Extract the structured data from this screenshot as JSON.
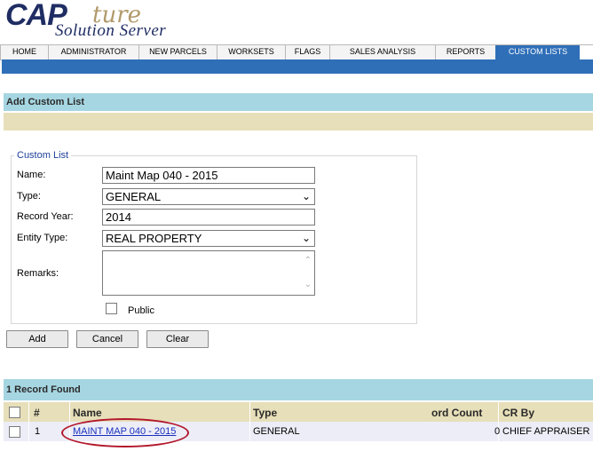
{
  "logo": {
    "cap": "CAP",
    "ture": "ture",
    "subtitle": "Solution Server"
  },
  "nav": {
    "tabs": [
      {
        "label": "HOME",
        "active": false
      },
      {
        "label": "ADMINISTRATOR",
        "active": false
      },
      {
        "label": "NEW PARCELS",
        "active": false
      },
      {
        "label": "WORKSETS",
        "active": false
      },
      {
        "label": "FLAGS",
        "active": false
      },
      {
        "label": "SALES ANALYSIS",
        "active": false
      },
      {
        "label": "REPORTS",
        "active": false
      },
      {
        "label": "CUSTOM LISTS",
        "active": true
      }
    ]
  },
  "form": {
    "section_title": "Add Custom List",
    "legend": "Custom List",
    "name_label": "Name:",
    "name_value": "Maint Map 040 - 2015",
    "type_label": "Type:",
    "type_value": "GENERAL",
    "record_year_label": "Record Year:",
    "record_year_value": "2014",
    "entity_type_label": "Entity Type:",
    "entity_type_value": "REAL PROPERTY",
    "remarks_label": "Remarks:",
    "remarks_value": "",
    "public_label": "Public",
    "public_checked": false,
    "add_label": "Add",
    "cancel_label": "Cancel",
    "clear_label": "Clear"
  },
  "results": {
    "title": "1 Record Found",
    "columns": {
      "num": "#",
      "name": "Name",
      "type": "Type",
      "record_count": "ord Count",
      "cr_by": "CR By"
    },
    "rows": [
      {
        "num": "1",
        "name": "MAINT MAP 040 - 2015",
        "type": "GENERAL",
        "record_count": "0",
        "cr_by": "CHIEF APPRAISER"
      }
    ]
  },
  "colors": {
    "nav_active": "#2f6fb8",
    "section_bar": "#a6d6e2",
    "tan_bar": "#e7dfb9",
    "annotation_oval": "#b3172b"
  }
}
